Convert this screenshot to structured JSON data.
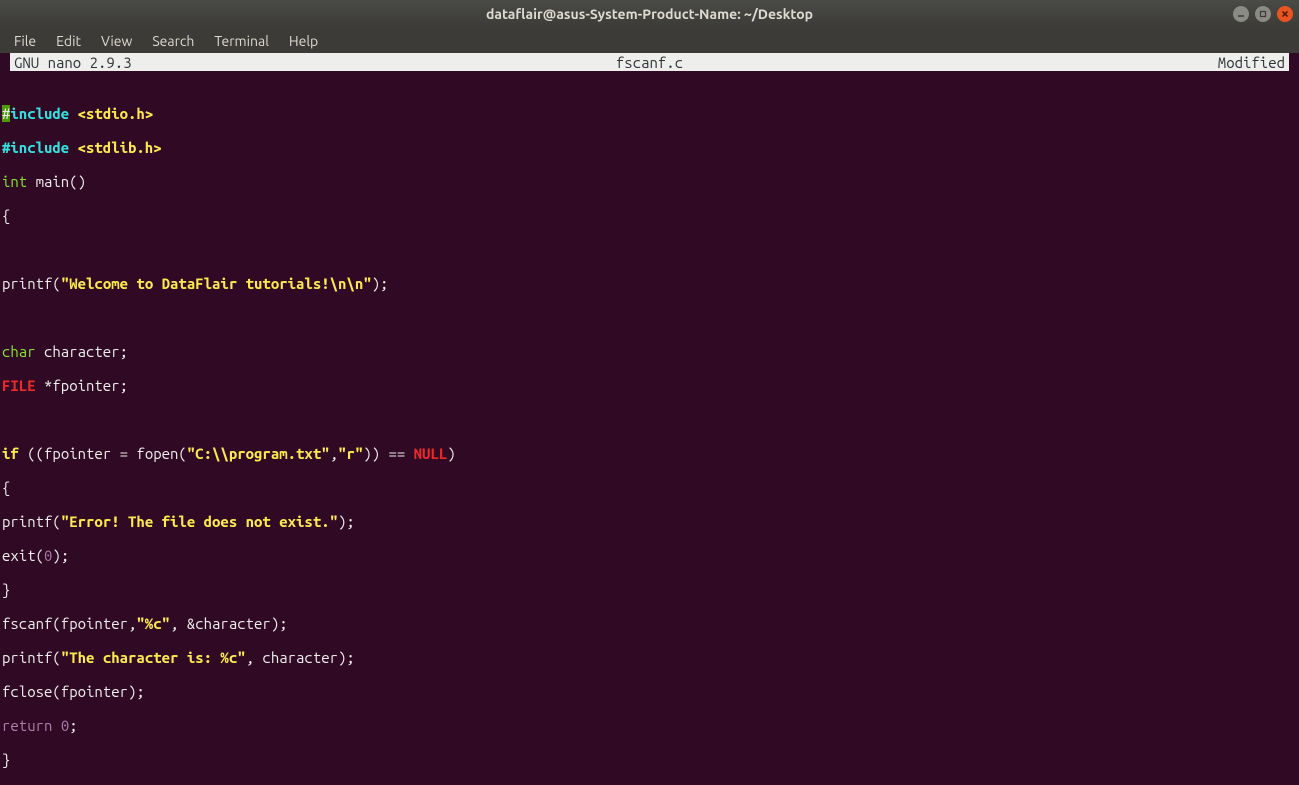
{
  "window": {
    "title": "dataflair@asus-System-Product-Name: ~/Desktop"
  },
  "menubar": {
    "items": [
      "File",
      "Edit",
      "View",
      "Search",
      "Terminal",
      "Help"
    ]
  },
  "nano": {
    "version": "  GNU nano 2.9.3",
    "filename": "fscanf.c",
    "status": "Modified"
  },
  "code": {
    "l1_hash": "#",
    "l1_include": "include",
    "l1_header": " <stdio.h>",
    "l2_pre": "#include",
    "l2_header": " <stdlib.h>",
    "l3_int": "int",
    "l3_main": " main()",
    "l4": "{",
    "l5": "",
    "l6_pre": "printf(",
    "l6_str": "\"Welcome to DataFlair tutorials!\\n\\n\"",
    "l6_post": ");",
    "l7": "",
    "l8_char": "char",
    "l8_rest": " character;",
    "l9_file": "FILE",
    "l9_rest": " *fpointer;",
    "l10": "",
    "l11_if": "if",
    "l11_mid1": " ((fpointer = fopen(",
    "l11_str1": "\"C:\\\\program.txt\"",
    "l11_comma": ",",
    "l11_str2": "\"r\"",
    "l11_mid2": ")) == ",
    "l11_null": "NULL",
    "l11_end": ")",
    "l12": "{",
    "l13_pre": "printf(",
    "l13_str": "\"Error! The file does not exist.\"",
    "l13_post": ");",
    "l14_exit": "exit(",
    "l14_zero": "0",
    "l14_end": ");",
    "l15": "}",
    "l16_pre": "fscanf(fpointer,",
    "l16_str": "\"%c\"",
    "l16_post": ", &character);",
    "l17_pre": "printf(",
    "l17_str": "\"The character is: %c\"",
    "l17_post": ", character);",
    "l18": "fclose(fpointer);",
    "l19_ret": "return",
    "l19_sp": " ",
    "l19_zero": "0",
    "l19_semi": ";",
    "l20": "}"
  }
}
